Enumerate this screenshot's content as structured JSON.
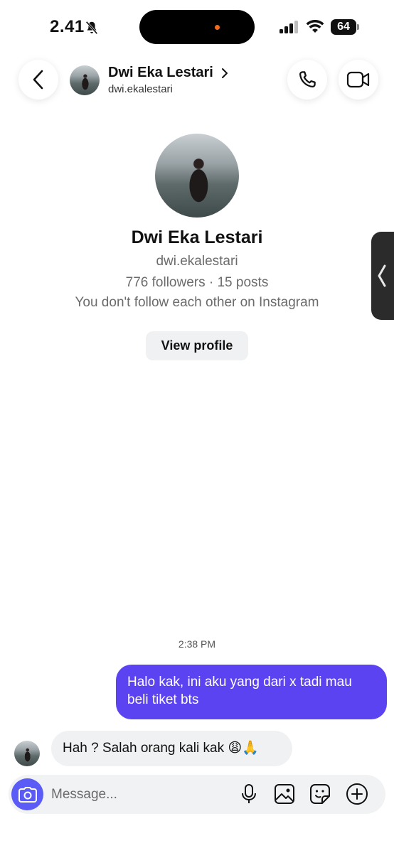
{
  "status_bar": {
    "time": "2.41",
    "battery": "64"
  },
  "header": {
    "name": "Dwi Eka Lestari",
    "username": "dwi.ekalestari"
  },
  "profile": {
    "name": "Dwi Eka Lestari",
    "username": "dwi.ekalestari",
    "stats": "776 followers · 15 posts",
    "note": "You don't follow each other on Instagram",
    "view_profile_label": "View profile"
  },
  "chat": {
    "timestamp": "2:38 PM",
    "messages": [
      {
        "direction": "outgoing",
        "text": "Halo kak, ini aku yang dari x tadi mau beli tiket bts"
      },
      {
        "direction": "incoming",
        "text": "Hah ? Salah orang kali kak 😩🙏"
      }
    ]
  },
  "composer": {
    "placeholder": "Message..."
  },
  "icons": {
    "back": "chevron-left-icon",
    "call": "phone-icon",
    "video": "video-camera-icon",
    "camera": "camera-icon",
    "mic": "microphone-icon",
    "gallery": "image-icon",
    "sticker": "sticker-icon",
    "plus": "plus-icon"
  },
  "colors": {
    "accent": "#5b43f2",
    "camera_button": "#5b5cf6",
    "incoming_bubble": "#eff1f3"
  }
}
